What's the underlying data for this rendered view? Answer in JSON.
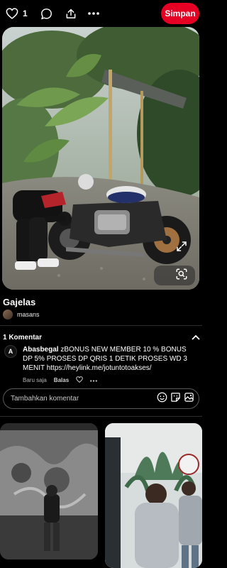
{
  "toolbar": {
    "like_count": "1",
    "save_label": "Simpan"
  },
  "pin": {
    "title": "Gajelas",
    "author": "masans"
  },
  "comments": {
    "count_label": "1 Komentar",
    "items": [
      {
        "avatar_letter": "A",
        "user": "Abasbegal",
        "text": "zBONUS NEW MEMBER 10 % BONUS DP 5% PROSES DP QRIS 1 DETIK PROSES WD 3 MENIT https://heylink.me/jotuntotoakses/",
        "time": "Baru saja",
        "reply_label": "Balas"
      }
    ],
    "input_placeholder": "Tambahkan komentar"
  },
  "colors": {
    "accent": "#e60023",
    "background": "#000000"
  },
  "icons": [
    "heart-icon",
    "chat-bubble-icon",
    "share-icon",
    "more-icon",
    "expand-icon",
    "visual-search-icon",
    "chevron-up-icon",
    "emoji-icon",
    "sticker-icon",
    "image-icon"
  ]
}
